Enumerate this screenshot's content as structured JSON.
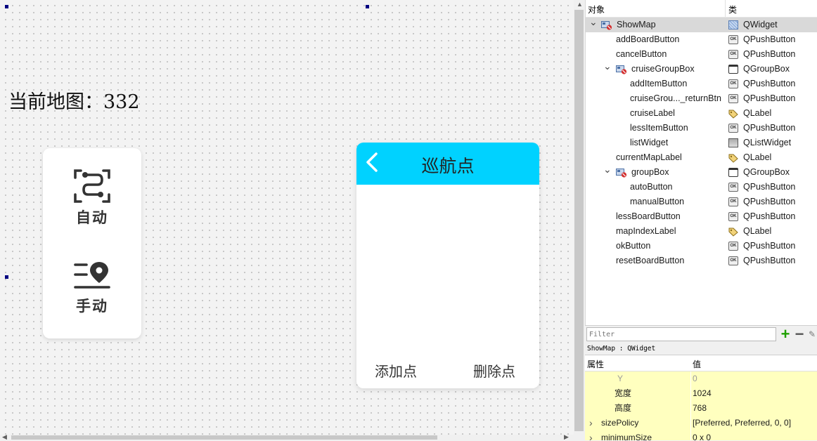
{
  "canvas": {
    "current_map_label": "当前地图：332",
    "mode_buttons": [
      {
        "label": "自动",
        "icon": "auto-route-icon"
      },
      {
        "label": "手动",
        "icon": "manual-location-icon"
      }
    ],
    "cruise": {
      "title": "巡航点",
      "back_icon": "chevron-left-icon",
      "add_label": "添加点",
      "delete_label": "删除点",
      "header_color": "#00d2ff"
    }
  },
  "inspector": {
    "col_object": "对象",
    "col_class": "类",
    "rows": [
      {
        "name": "ShowMap",
        "cls": "QWidget",
        "level": 0,
        "expand": true,
        "selected": true,
        "kind": "widget"
      },
      {
        "name": "addBoardButton",
        "cls": "QPushButton",
        "level": 1,
        "kind": "pushbutton"
      },
      {
        "name": "cancelButton",
        "cls": "QPushButton",
        "level": 1,
        "kind": "pushbutton"
      },
      {
        "name": "cruiseGroupBox",
        "cls": "QGroupBox",
        "level": 1,
        "expand": true,
        "kind": "groupbox"
      },
      {
        "name": "addItemButton",
        "cls": "QPushButton",
        "level": 2,
        "kind": "pushbutton"
      },
      {
        "name": "cruiseGrou..._returnBtn",
        "cls": "QPushButton",
        "level": 2,
        "kind": "pushbutton"
      },
      {
        "name": "cruiseLabel",
        "cls": "QLabel",
        "level": 2,
        "kind": "label"
      },
      {
        "name": "lessItemButton",
        "cls": "QPushButton",
        "level": 2,
        "kind": "pushbutton"
      },
      {
        "name": "listWidget",
        "cls": "QListWidget",
        "level": 2,
        "kind": "list"
      },
      {
        "name": "currentMapLabel",
        "cls": "QLabel",
        "level": 1,
        "kind": "label"
      },
      {
        "name": "groupBox",
        "cls": "QGroupBox",
        "level": 1,
        "expand": true,
        "kind": "groupbox"
      },
      {
        "name": "autoButton",
        "cls": "QPushButton",
        "level": 2,
        "kind": "pushbutton"
      },
      {
        "name": "manualButton",
        "cls": "QPushButton",
        "level": 2,
        "kind": "pushbutton"
      },
      {
        "name": "lessBoardButton",
        "cls": "QPushButton",
        "level": 1,
        "kind": "pushbutton"
      },
      {
        "name": "mapIndexLabel",
        "cls": "QLabel",
        "level": 1,
        "kind": "label"
      },
      {
        "name": "okButton",
        "cls": "QPushButton",
        "level": 1,
        "kind": "pushbutton"
      },
      {
        "name": "resetBoardButton",
        "cls": "QPushButton",
        "level": 1,
        "kind": "pushbutton"
      }
    ]
  },
  "filter": {
    "placeholder": "Filter",
    "add_icon": "plus-icon",
    "remove_icon": "minus-icon",
    "config_icon": "wrench-icon"
  },
  "properties": {
    "caption": "ShowMap : QWidget",
    "col_property": "属性",
    "col_value": "值",
    "rows": [
      {
        "name": "Y",
        "value": "0",
        "dim": true
      },
      {
        "name": "宽度",
        "value": "1024"
      },
      {
        "name": "高度",
        "value": "768"
      },
      {
        "name": "sizePolicy",
        "value": "[Preferred, Preferred, 0, 0]",
        "expandable": true
      },
      {
        "name": "minimumSize",
        "value": "0 x 0",
        "expandable": true
      }
    ]
  },
  "colors": {
    "selection_row": "#d9d9d9",
    "property_row": "#ffffbf",
    "handle": "#000080"
  }
}
